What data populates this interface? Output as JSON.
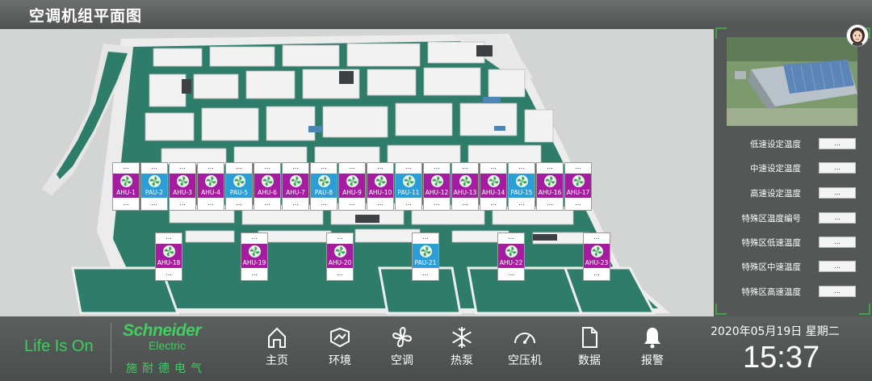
{
  "header": {
    "title": "空调机组平面图"
  },
  "units_row1": [
    {
      "name": "AHU-1",
      "type": "ahu",
      "top": "...",
      "bottom": "..."
    },
    {
      "name": "PAU-2",
      "type": "pau",
      "top": "...",
      "bottom": "..."
    },
    {
      "name": "AHU-3",
      "type": "ahu",
      "top": "...",
      "bottom": "..."
    },
    {
      "name": "AHU-4",
      "type": "ahu",
      "top": "...",
      "bottom": "..."
    },
    {
      "name": "PAU-5",
      "type": "pau",
      "top": "...",
      "bottom": "..."
    },
    {
      "name": "AHU-6",
      "type": "ahu",
      "top": "...",
      "bottom": "..."
    },
    {
      "name": "AHU-7",
      "type": "ahu",
      "top": "...",
      "bottom": "..."
    },
    {
      "name": "PAU-8",
      "type": "pau",
      "top": "...",
      "bottom": "..."
    },
    {
      "name": "AHU-9",
      "type": "ahu",
      "top": "...",
      "bottom": "..."
    },
    {
      "name": "AHU-10",
      "type": "ahu",
      "top": "...",
      "bottom": "..."
    },
    {
      "name": "PAU-11",
      "type": "pau",
      "top": "...",
      "bottom": "..."
    },
    {
      "name": "AHU-12",
      "type": "ahu",
      "top": "...",
      "bottom": "..."
    },
    {
      "name": "AHU-13",
      "type": "ahu",
      "top": "...",
      "bottom": "..."
    },
    {
      "name": "AHU-14",
      "type": "ahu",
      "top": "...",
      "bottom": "..."
    },
    {
      "name": "PAU-15",
      "type": "pau",
      "top": "...",
      "bottom": "..."
    },
    {
      "name": "AHU-16",
      "type": "ahu",
      "top": "...",
      "bottom": "..."
    },
    {
      "name": "AHU-17",
      "type": "ahu",
      "top": "...",
      "bottom": "..."
    }
  ],
  "units_row2": [
    {
      "name": "AHU-18",
      "type": "ahu",
      "top": "...",
      "bottom": "..."
    },
    {
      "name": "AHU-19",
      "type": "ahu",
      "top": "...",
      "bottom": "..."
    },
    {
      "name": "AHU-20",
      "type": "ahu",
      "top": "...",
      "bottom": "..."
    },
    {
      "name": "PAU-21",
      "type": "pau",
      "top": "...",
      "bottom": "..."
    },
    {
      "name": "AHU-22",
      "type": "ahu",
      "top": "...",
      "bottom": "..."
    },
    {
      "name": "AHU-23",
      "type": "ahu",
      "top": "...",
      "bottom": "..."
    }
  ],
  "params": [
    {
      "label": "低速设定温度",
      "value": "..."
    },
    {
      "label": "中速设定温度",
      "value": "..."
    },
    {
      "label": "高速设定温度",
      "value": "..."
    },
    {
      "label": "特殊区温度编号",
      "value": "..."
    },
    {
      "label": "特殊区低速温度",
      "value": "..."
    },
    {
      "label": "特殊区中速温度",
      "value": "..."
    },
    {
      "label": "特殊区高速温度",
      "value": "..."
    }
  ],
  "footer": {
    "slogan": "Life Is On",
    "brand": {
      "name": "Schneider",
      "sub": "Electric",
      "cn": "施耐德电气"
    },
    "nav": [
      {
        "label": "主页",
        "icon": "home-icon"
      },
      {
        "label": "环境",
        "icon": "environment-icon"
      },
      {
        "label": "空调",
        "icon": "fan-icon"
      },
      {
        "label": "热泵",
        "icon": "snowflake-icon"
      },
      {
        "label": "空压机",
        "icon": "gauge-icon"
      },
      {
        "label": "数据",
        "icon": "document-icon"
      },
      {
        "label": "报警",
        "icon": "bell-icon"
      }
    ],
    "date": "2020年05月19日 星期二",
    "time": "15:37"
  },
  "colors": {
    "ahu": "#a61ca0",
    "pau": "#2b9ed8",
    "brand_green": "#3fcf60",
    "floor_green": "#2e7d6b"
  }
}
